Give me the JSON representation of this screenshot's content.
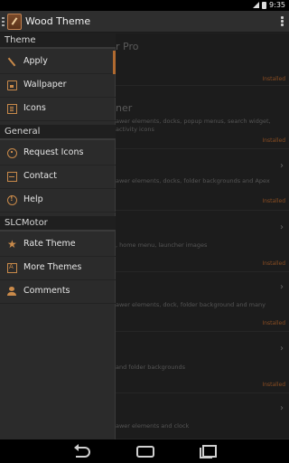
{
  "status_bar": {
    "time": "9:35"
  },
  "action_bar": {
    "title": "Wood Theme"
  },
  "drawer": {
    "sections": [
      {
        "title": "Theme",
        "items": [
          {
            "label": "Apply",
            "icon": "brush-icon",
            "selected": true
          },
          {
            "label": "Wallpaper",
            "icon": "wallpaper-icon"
          },
          {
            "label": "Icons",
            "icon": "icons-icon"
          }
        ]
      },
      {
        "title": "General",
        "items": [
          {
            "label": "Request Icons",
            "icon": "request-icons-icon"
          },
          {
            "label": "Contact",
            "icon": "contact-icon"
          },
          {
            "label": "Help",
            "icon": "help-icon"
          }
        ]
      },
      {
        "title": "SLCMotor",
        "items": [
          {
            "label": "Rate Theme",
            "icon": "star-icon"
          },
          {
            "label": "More Themes",
            "icon": "more-themes-icon"
          },
          {
            "label": "Comments",
            "icon": "comments-icon"
          }
        ]
      }
    ]
  },
  "background_cards": [
    {
      "title": "r Pro",
      "desc": "",
      "status": "Installed"
    },
    {
      "title": "ner",
      "desc": "awer elements, docks, popup menus, search widget, activity icons",
      "status": "Installed"
    },
    {
      "title": "",
      "desc": "awer elements, docks, folder backgrounds and Apex",
      "status": "Installed"
    },
    {
      "title": "",
      "desc": ", home menu, launcher images",
      "status": "Installed"
    },
    {
      "title": "",
      "desc": "awer elements, dock, folder background and many",
      "status": "Installed"
    },
    {
      "title": "",
      "desc": "and folder backgrounds",
      "status": "Installed"
    },
    {
      "title": "",
      "desc": "awer elements and clock",
      "status": ""
    }
  ],
  "colors": {
    "accent": "#c98a4a",
    "drawer_bg": "#2b2b2b",
    "header_bg": "#1f1f1f"
  }
}
